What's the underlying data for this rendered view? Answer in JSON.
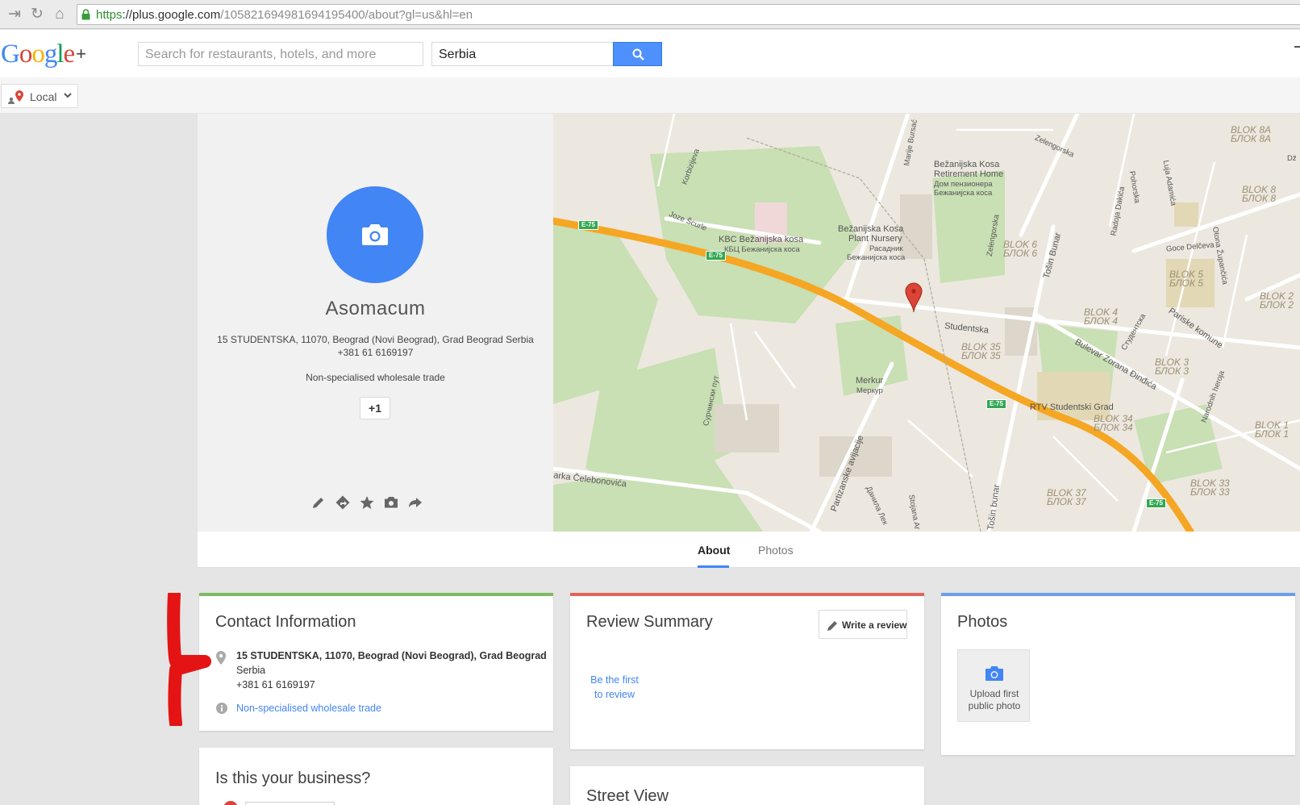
{
  "browser": {
    "url_scheme": "https",
    "url_host": "://plus.google.com",
    "url_path": "/105821694981694195400/about?gl=us&hl=en"
  },
  "header": {
    "logo_letters": [
      "G",
      "o",
      "o",
      "g",
      "l",
      "e"
    ],
    "logo_colors": [
      "#4285f4",
      "#db4437",
      "#f4b400",
      "#4285f4",
      "#0f9d58",
      "#db4437"
    ],
    "logo_plus": "+",
    "search_what_placeholder": "Search for restaurants, hotels, and more",
    "search_where_value": "Serbia"
  },
  "localbar": {
    "label": "Local"
  },
  "profile": {
    "name": "Asomacum",
    "address": "15 STUDENTSKA, 11070, Beograd (Novi Beograd), Grad Beograd Serbia",
    "phone": "+381 61 6169197",
    "category": "Non-specialised wholesale trade",
    "plusone_label": "+1"
  },
  "map": {
    "labels": {
      "kbc_lat": "KBC Bežanijska kosa",
      "kbc_cyr": "КБЦ Бежанијска коса",
      "home_1": "Bežanijska Kosa",
      "home_2": "Retirement Home",
      "home_3": "Дом пензионера",
      "home_4": "Бежанијска коса",
      "nursery_1": "Bežanijska Kosa",
      "nursery_2": "Plant Nursery",
      "nursery_3": "Расадник",
      "nursery_4": "Бежанијска коса",
      "merkur_lat": "Merkur",
      "merkur_cyr": "Меркур",
      "rtv": "RTV Studentski Grad",
      "studentska": "Studentska",
      "joze": "Joze Šcurle",
      "korbizijeva": "Korbizijeva",
      "marije": "Marije Bursać",
      "zelengorska": "Zelengorska",
      "zelengorska2": "Zelengorska",
      "pohorska": "Pohorska",
      "luja": "Luja Adamića",
      "radoja": "Radoja Dakića",
      "otona": "Otona Župančića",
      "goce": "Goce Delčeva",
      "tosin1": "Tošin Bunar",
      "tosin2": "Tošin bunar",
      "pariske": "Pariske komune",
      "bulevar": "Bulevar Zorana Đinđića",
      "studentska_cyr": "Студентска",
      "narodnih": "Narodnih heroja",
      "surcinski": "Сурчински пут",
      "partizanske": "Partizanske avijacije",
      "danila": "Данила Лек",
      "stojana": "Stojana Ar",
      "celebonovica": "arka Čelebonovića",
      "dz": "Dž"
    },
    "blocks": {
      "b8a": "BLOK 8A",
      "b8a_c": "БЛОК 8А",
      "b8": "BLOK 8",
      "b8_c": "БЛОК 8",
      "b6": "BLOK 6",
      "b6_c": "БЛОК 6",
      "b5": "BLOK 5",
      "b5_c": "БЛОК 5",
      "b4": "BLOK 4",
      "b4_c": "БЛОК 4",
      "b35": "BLOK 35",
      "b35_c": "БЛОК 35",
      "b3": "BLOK 3",
      "b3_c": "БЛОК 3",
      "b2": "BLOK 2",
      "b2_c": "БЛОК 2",
      "b34": "BLOK 34",
      "b34_c": "БЛОК 34",
      "b1": "BLOK 1",
      "b1_c": "БЛОК 1",
      "b37": "BLOK 37",
      "b37_c": "БЛОК 37",
      "b33": "BLOK 33",
      "b33_c": "БЛОК 33"
    },
    "highway": "E-75",
    "road_color": "#f5a623",
    "park_color": "#c9dfb4"
  },
  "tabs": {
    "about": "About",
    "photos": "Photos"
  },
  "contact": {
    "title": "Contact Information",
    "address_line1": "15 STUDENTSKA, 11070, Beograd (Novi Beograd), Grad Beograd",
    "address_line2": "Serbia",
    "phone": "+381 61 6169197",
    "category": "Non-specialised wholesale trade",
    "accent": "#7cb960"
  },
  "review": {
    "title": "Review Summary",
    "write_review": "Write a review",
    "be_first_line1": "Be the first",
    "be_first_line2": "to review",
    "accent": "#e0655a"
  },
  "photos": {
    "title": "Photos",
    "upload_line1": "Upload first",
    "upload_line2": "public photo",
    "accent": "#6d9eeb"
  },
  "business": {
    "title": "Is this your business?"
  },
  "streetview": {
    "title": "Street View"
  },
  "annotation_color": "#e41414"
}
